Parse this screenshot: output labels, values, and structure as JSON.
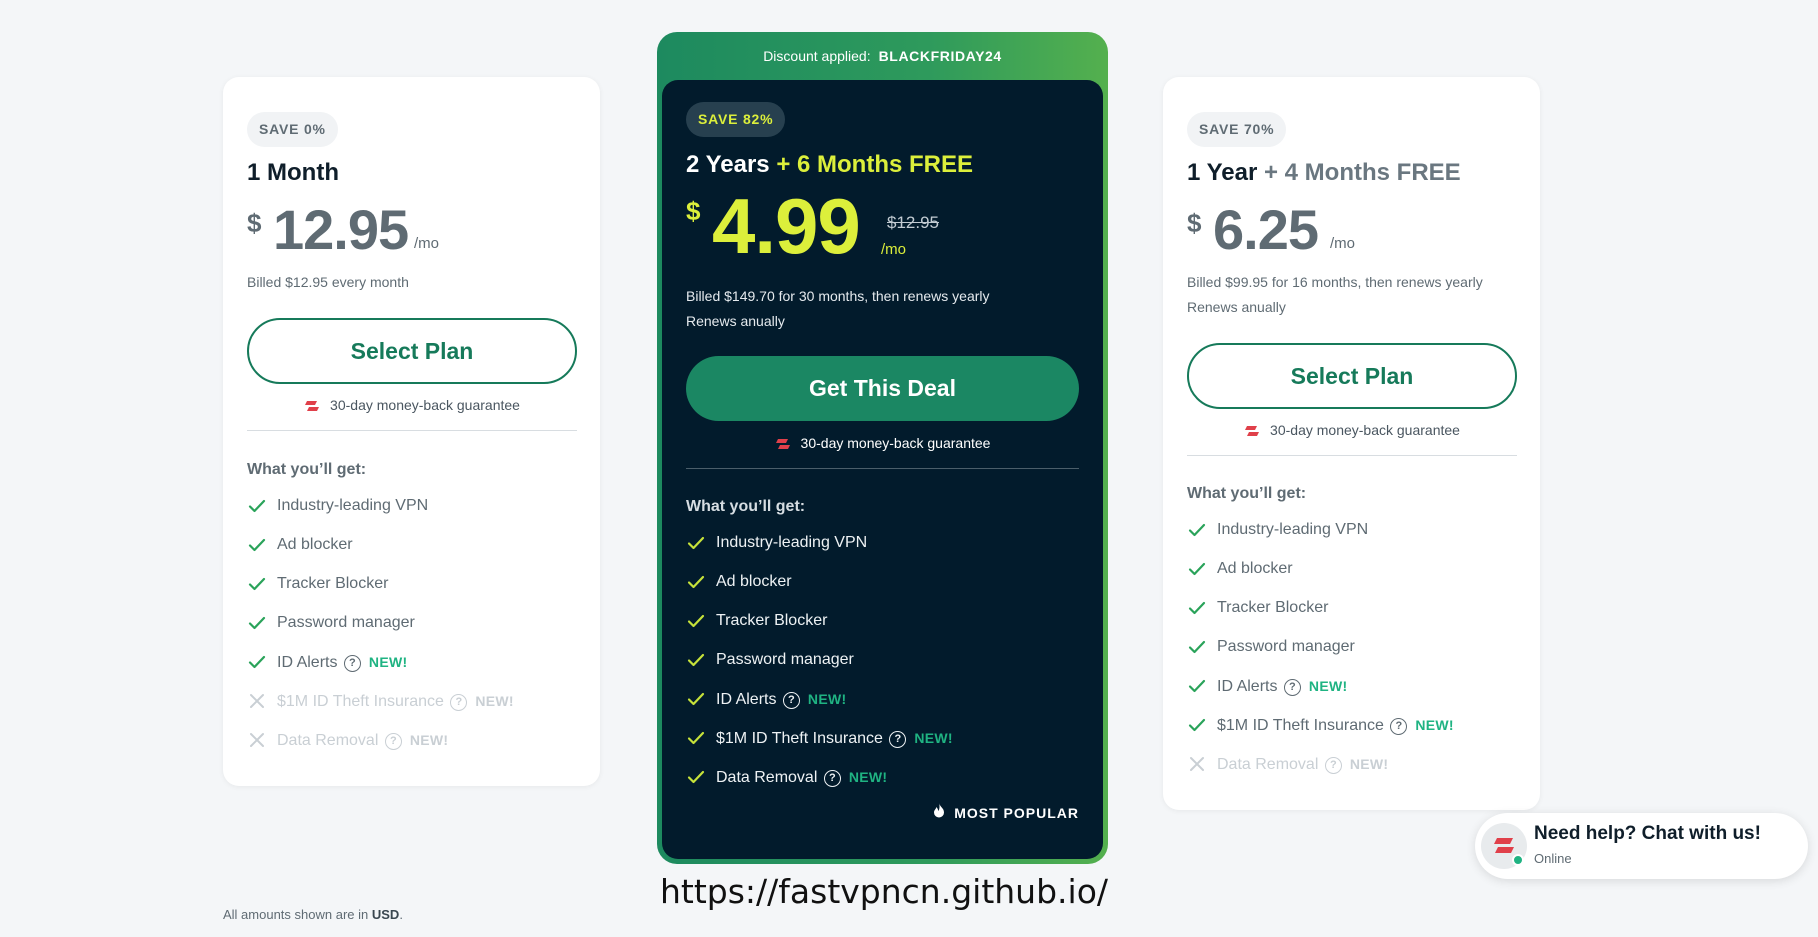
{
  "cards": [
    {
      "save": "SAVE 0%",
      "title": "1 Month",
      "title_extra": "",
      "currency": "$",
      "price": "12.95",
      "per": "/mo",
      "billed_1": "Billed $12.95 every month",
      "billed_2": "",
      "button": "Select Plan",
      "guarantee": "30-day money-back guarantee",
      "get_title": "What you’ll get:",
      "features": [
        {
          "label": "Industry-leading VPN",
          "included": true,
          "new": "",
          "help": false
        },
        {
          "label": "Ad blocker",
          "included": true,
          "new": "",
          "help": false
        },
        {
          "label": "Tracker Blocker",
          "included": true,
          "new": "",
          "help": false
        },
        {
          "label": "Password manager",
          "included": true,
          "new": "",
          "help": false
        },
        {
          "label": "ID Alerts",
          "included": true,
          "new": "NEW!",
          "help": true
        },
        {
          "label": "$1M ID Theft Insurance",
          "included": false,
          "new": "NEW!",
          "help": true
        },
        {
          "label": "Data Removal",
          "included": false,
          "new": "NEW!",
          "help": true
        }
      ]
    },
    {
      "banner_label": "Discount applied:",
      "banner_code": "BLACKFRIDAY24",
      "save": "SAVE 82%",
      "title": "2 Years",
      "title_extra": " + 6 Months FREE",
      "currency": "$",
      "price": "4.99",
      "old_price": "$12.95",
      "per": "/mo",
      "billed_1": "Billed $149.70 for 30 months, then renews yearly",
      "billed_2": "Renews anually",
      "button": "Get This Deal",
      "guarantee": "30-day money-back guarantee",
      "get_title": "What you’ll get:",
      "features": [
        {
          "label": "Industry-leading VPN",
          "included": true,
          "new": "",
          "help": false
        },
        {
          "label": "Ad blocker",
          "included": true,
          "new": "",
          "help": false
        },
        {
          "label": "Tracker Blocker",
          "included": true,
          "new": "",
          "help": false
        },
        {
          "label": "Password manager",
          "included": true,
          "new": "",
          "help": false
        },
        {
          "label": "ID Alerts",
          "included": true,
          "new": "NEW!",
          "help": true
        },
        {
          "label": "$1M ID Theft Insurance",
          "included": true,
          "new": "NEW!",
          "help": true
        },
        {
          "label": "Data Removal",
          "included": true,
          "new": "NEW!",
          "help": true
        }
      ],
      "popular": "MOST POPULAR"
    },
    {
      "save": "SAVE 70%",
      "title": "1 Year",
      "title_extra": " + 4 Months FREE",
      "currency": "$",
      "price": "6.25",
      "per": "/mo",
      "billed_1": "Billed $99.95 for 16 months, then renews yearly",
      "billed_2": "Renews anually",
      "button": "Select Plan",
      "guarantee": "30-day money-back guarantee",
      "get_title": "What you’ll get:",
      "features": [
        {
          "label": "Industry-leading VPN",
          "included": true,
          "new": "",
          "help": false
        },
        {
          "label": "Ad blocker",
          "included": true,
          "new": "",
          "help": false
        },
        {
          "label": "Tracker Blocker",
          "included": true,
          "new": "",
          "help": false
        },
        {
          "label": "Password manager",
          "included": true,
          "new": "",
          "help": false
        },
        {
          "label": "ID Alerts",
          "included": true,
          "new": "NEW!",
          "help": true
        },
        {
          "label": "$1M ID Theft Insurance",
          "included": true,
          "new": "NEW!",
          "help": true
        },
        {
          "label": "Data Removal",
          "included": false,
          "new": "NEW!",
          "help": true
        }
      ]
    }
  ],
  "footer": {
    "prefix": "All amounts shown are in ",
    "currency": "USD",
    "suffix": "."
  },
  "url_text": "https://fastvpncn.github.io/",
  "chat": {
    "title": "Need help? Chat with us!",
    "status": "Online"
  },
  "icons": {
    "check": "check-icon",
    "cross": "cross-icon",
    "help": "help-circle-icon",
    "guarantee": "shield-badge-icon",
    "flame": "flame-icon"
  },
  "colors": {
    "accent_green": "#167a5a",
    "highlight_yellow": "#dcef3b",
    "dark_card": "#021b2c",
    "new_badge": "#1fb382"
  }
}
